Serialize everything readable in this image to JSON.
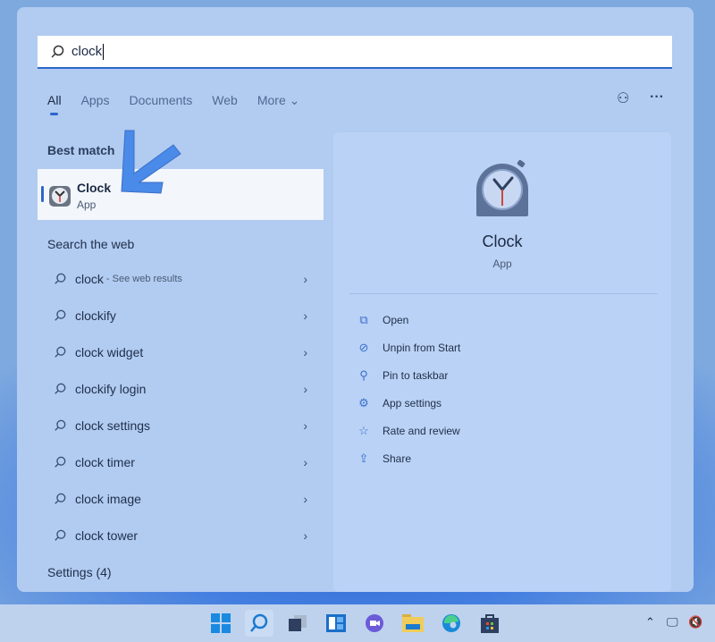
{
  "search": {
    "value": "clock"
  },
  "tabs": [
    {
      "label": "All"
    },
    {
      "label": "Apps"
    },
    {
      "label": "Documents"
    },
    {
      "label": "Web"
    },
    {
      "label": "More ⌄"
    }
  ],
  "sections": {
    "best_match": "Best match",
    "search_web": "Search the web",
    "settings": "Settings (4)"
  },
  "best_match": {
    "title": "Clock",
    "subtitle": "App"
  },
  "web_results": [
    {
      "text": "clock",
      "sub": "- See web results"
    },
    {
      "text": "clockify"
    },
    {
      "text": "clock widget"
    },
    {
      "text": "clockify login"
    },
    {
      "text": "clock settings"
    },
    {
      "text": "clock timer"
    },
    {
      "text": "clock image"
    },
    {
      "text": "clock tower"
    }
  ],
  "detail": {
    "name": "Clock",
    "type": "App",
    "actions": [
      {
        "label": "Open",
        "icon": "open-icon"
      },
      {
        "label": "Unpin from Start",
        "icon": "unpin-icon"
      },
      {
        "label": "Pin to taskbar",
        "icon": "pin-icon"
      },
      {
        "label": "App settings",
        "icon": "gear-icon"
      },
      {
        "label": "Rate and review",
        "icon": "star-icon"
      },
      {
        "label": "Share",
        "icon": "share-icon"
      }
    ]
  },
  "colors": {
    "accent": "#2c66c9",
    "arrow": "#4a8ae8"
  }
}
